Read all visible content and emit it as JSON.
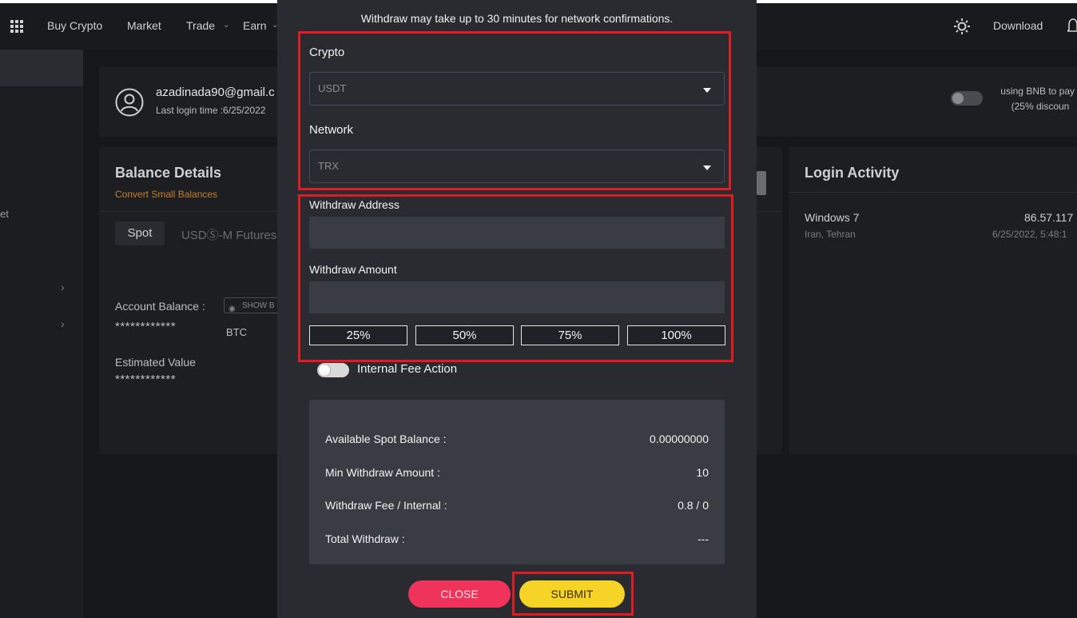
{
  "nav": {
    "items": [
      "Buy Crypto",
      "Market",
      "Trade",
      "Earn"
    ],
    "download": "Download"
  },
  "sidebar": {
    "partial_label": "et"
  },
  "profile": {
    "email": "azadinada90@gmail.c",
    "last_login": "Last login time :6/25/2022"
  },
  "fee_setting": {
    "line1": "using BNB to pay f",
    "line2": "(25% discoun"
  },
  "balance": {
    "title": "Balance Details",
    "convert_link": "Convert Small Balances",
    "tabs": [
      "Spot",
      "USDⓈ-M Futures"
    ],
    "account_label": "Account Balance :",
    "show_button": "SHOW B",
    "account_value": "************",
    "account_unit": "BTC",
    "estimated_label": "Estimated Value",
    "estimated_value": "************"
  },
  "login_activity": {
    "title": "Login Activity",
    "os": "Windows 7",
    "location": "Iran, Tehran",
    "ip": "86.57.117",
    "date": "6/25/2022, 5:48:1"
  },
  "modal": {
    "note": "Withdraw may take up to 30 minutes for network confirmations.",
    "crypto_label": "Crypto",
    "crypto_value": "USDT",
    "network_label": "Network",
    "network_value": "TRX",
    "address_label": "Withdraw Address",
    "address_value": "",
    "amount_label": "Withdraw Amount",
    "amount_value": "",
    "percent_buttons": [
      "25%",
      "50%",
      "75%",
      "100%"
    ],
    "internal_fee_label": "Internal Fee Action",
    "internal_fee_on": false,
    "summary": [
      {
        "label": "Available Spot Balance :",
        "value": "0.00000000"
      },
      {
        "label": "Min Withdraw Amount :",
        "value": "10"
      },
      {
        "label": "Withdraw Fee / Internal :",
        "value": "0.8 / 0"
      },
      {
        "label": "Total Withdraw :",
        "value": "---"
      }
    ],
    "close_label": "CLOSE",
    "submit_label": "SUBMIT"
  },
  "colors": {
    "highlight_box": "#e21b23",
    "submit": "#f5d327",
    "close": "#f0335a",
    "link": "#c57f2a"
  },
  "icons": [
    "apps-grid-icon",
    "chevron-down-icon",
    "sun-icon",
    "bell-icon",
    "user-avatar-icon",
    "eye-icon",
    "chevron-right-icon",
    "caret-down-icon"
  ]
}
